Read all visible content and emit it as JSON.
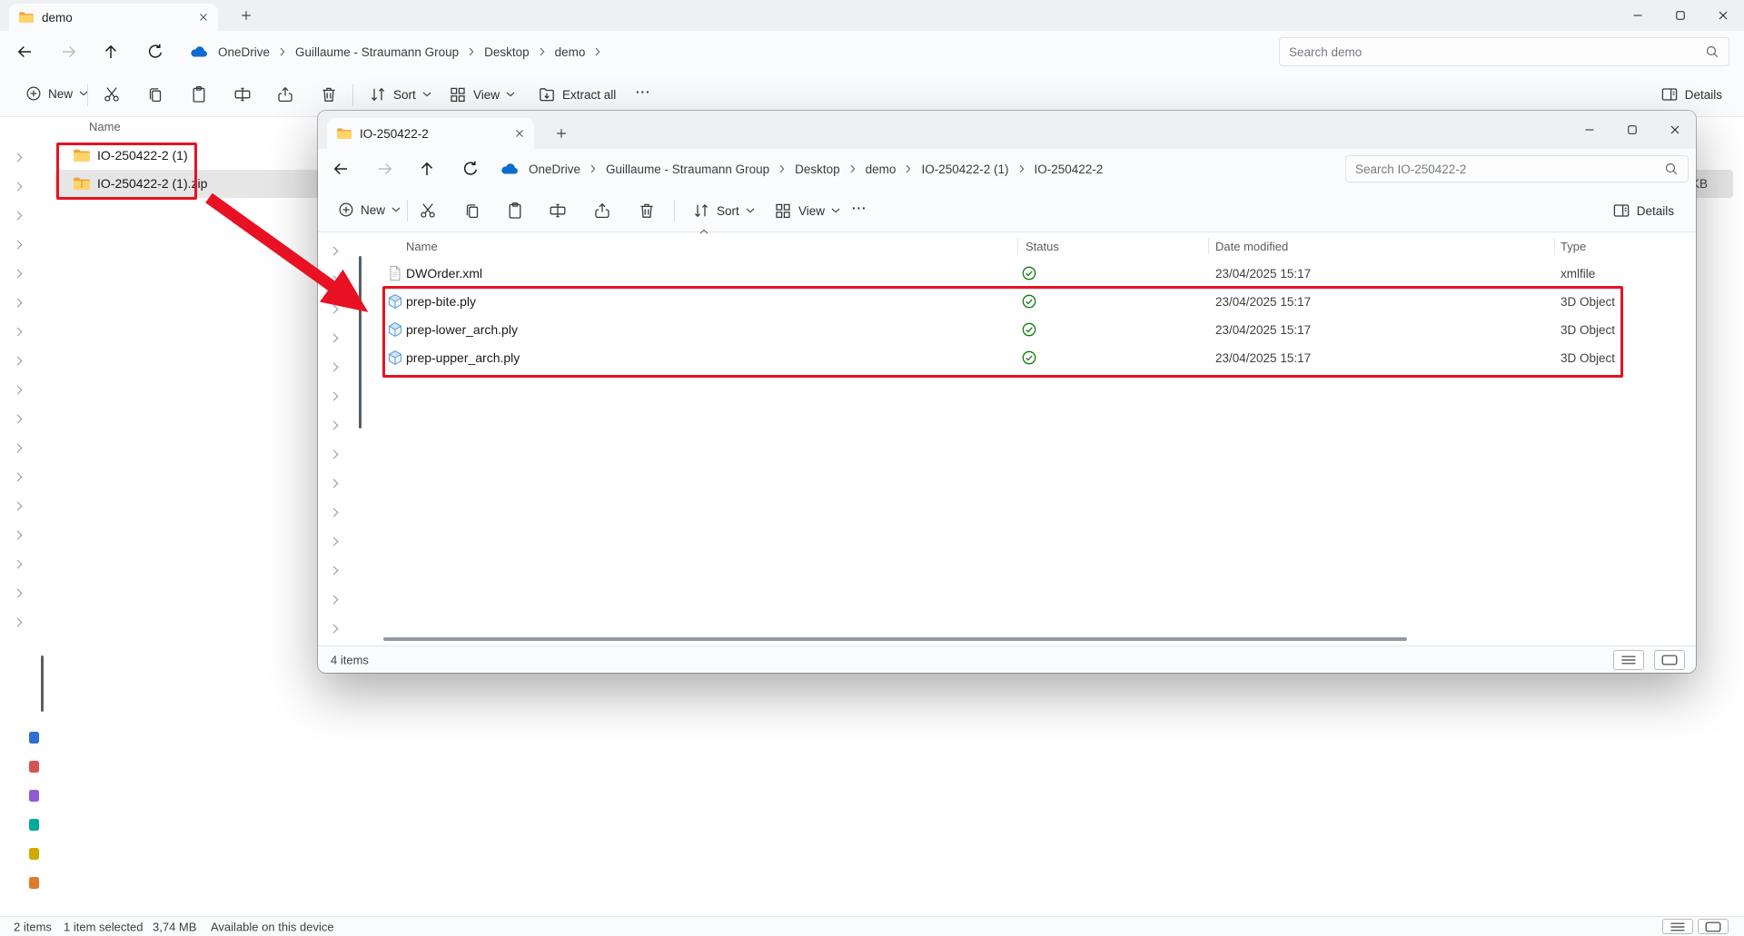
{
  "colors": {
    "accent_red": "#e81123"
  },
  "shared_toolbar": {
    "new": "New",
    "sort": "Sort",
    "view": "View",
    "extract_all": "Extract all",
    "more": "···",
    "details": "Details"
  },
  "background_window": {
    "tab_title": "demo",
    "breadcrumb": [
      "OneDrive",
      "Guillaume - Straumann Group",
      "Desktop",
      "demo"
    ],
    "search_placeholder": "Search demo",
    "columns": [
      "Name"
    ],
    "files": [
      {
        "name": "IO-250422-2 (1)",
        "icon": "folder",
        "selected": false,
        "size_tail": ""
      },
      {
        "name": "IO-250422-2 (1).zip",
        "icon": "zip-folder",
        "selected": true,
        "size_tail": "KB"
      }
    ],
    "sidebar_pinned_colors": [
      "#2f6fd6",
      "#d9534f",
      "#8e5bd4",
      "#00a99d",
      "#d4a800",
      "#e07a28"
    ],
    "status": {
      "count": "2 items",
      "selection": "1 item selected",
      "size": "3,74 MB",
      "availability": "Available on this device"
    }
  },
  "foreground_window": {
    "tab_title": "IO-250422-2",
    "breadcrumb": [
      "OneDrive",
      "Guillaume - Straumann Group",
      "Desktop",
      "demo",
      "IO-250422-2 (1)",
      "IO-250422-2"
    ],
    "search_placeholder": "Search IO-250422-2",
    "columns": {
      "name": "Name",
      "status": "Status",
      "date": "Date modified",
      "type": "Type"
    },
    "files": [
      {
        "name": "DWOrder.xml",
        "icon": "xml-document",
        "status_icon": "synced",
        "date": "23/04/2025 15:17",
        "type": "xmlfile"
      },
      {
        "name": "prep-bite.ply",
        "icon": "3d-object",
        "status_icon": "synced",
        "date": "23/04/2025 15:17",
        "type": "3D Object"
      },
      {
        "name": "prep-lower_arch.ply",
        "icon": "3d-object",
        "status_icon": "synced",
        "date": "23/04/2025 15:17",
        "type": "3D Object"
      },
      {
        "name": "prep-upper_arch.ply",
        "icon": "3d-object",
        "status_icon": "synced",
        "date": "23/04/2025 15:17",
        "type": "3D Object"
      }
    ],
    "status": {
      "count": "4 items"
    }
  }
}
